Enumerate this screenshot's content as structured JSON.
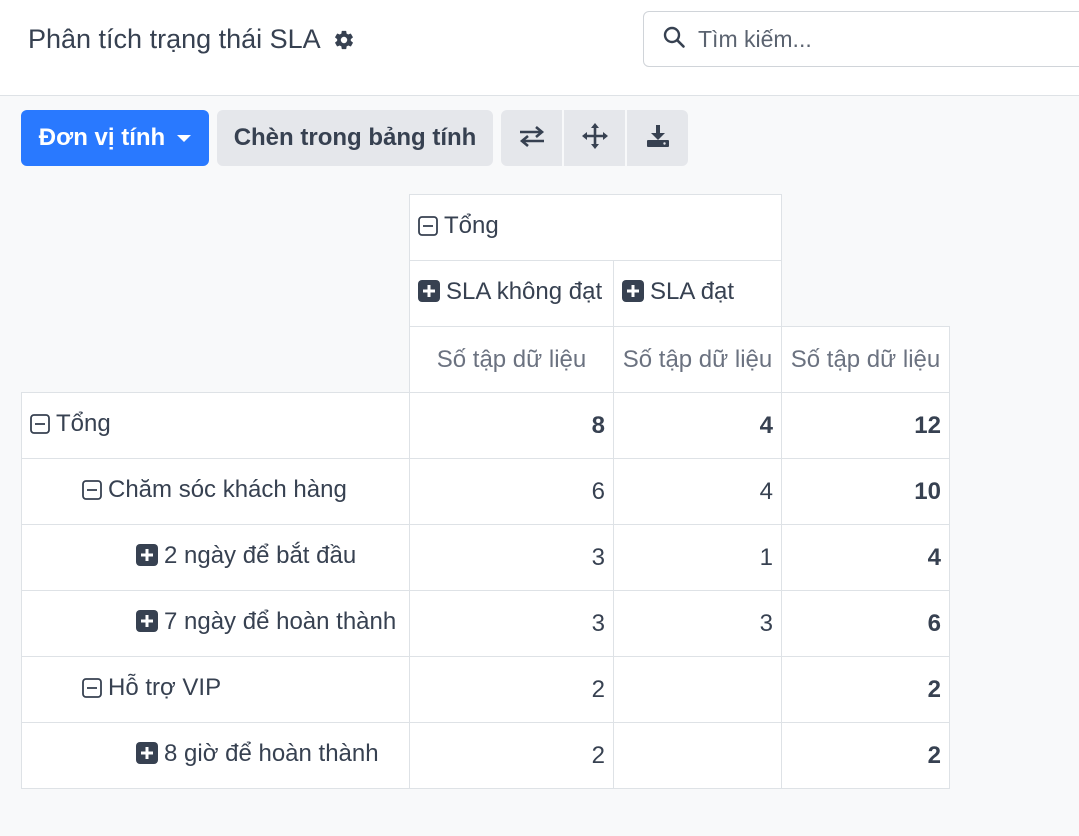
{
  "header": {
    "title": "Phân tích trạng thái SLA",
    "search_placeholder": "Tìm kiếm..."
  },
  "toolbar": {
    "measures_label": "Đơn vị tính",
    "insert_label": "Chèn trong bảng tính",
    "icons": [
      "swap-axis-icon",
      "expand-all-icon",
      "download-icon"
    ]
  },
  "pivot": {
    "col_total_label": "Tổng",
    "col_groups": [
      "SLA không đạt",
      "SLA đạt"
    ],
    "measure_label": "Số tập dữ liệu",
    "rows": [
      {
        "label": "Tổng",
        "level": 0,
        "icon": "minus",
        "values": [
          "8",
          "4",
          "12"
        ],
        "bold": true
      },
      {
        "label": "Chăm sóc khách hàng",
        "level": 1,
        "icon": "minus",
        "values": [
          "6",
          "4",
          "10"
        ],
        "bold": false
      },
      {
        "label": "2 ngày để bắt đầu",
        "level": 2,
        "icon": "plus",
        "values": [
          "3",
          "1",
          "4"
        ],
        "bold": false
      },
      {
        "label": "7 ngày để hoàn thành",
        "level": 2,
        "icon": "plus",
        "values": [
          "3",
          "3",
          "6"
        ],
        "bold": false
      },
      {
        "label": "Hỗ trợ VIP",
        "level": 1,
        "icon": "minus",
        "values": [
          "2",
          "",
          "2"
        ],
        "bold": false
      },
      {
        "label": "8 giờ để hoàn thành",
        "level": 2,
        "icon": "plus",
        "values": [
          "2",
          "",
          "2"
        ],
        "bold": false
      }
    ]
  },
  "colors": {
    "primary": "#2979ff",
    "secondary_bg": "#e5e7eb",
    "border": "#dee2e6"
  }
}
